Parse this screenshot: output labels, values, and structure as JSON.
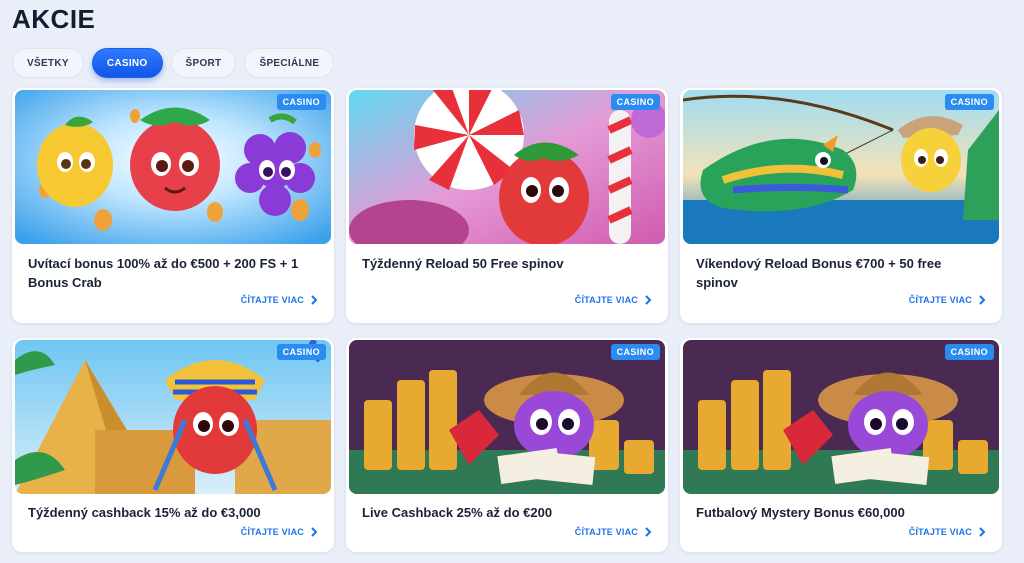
{
  "page": {
    "title": "AKCIE"
  },
  "tabs": [
    {
      "label": "VŠETKY",
      "active": false
    },
    {
      "label": "CASINO",
      "active": true
    },
    {
      "label": "ŠPORT",
      "active": false
    },
    {
      "label": "ŠPECIÁLNE",
      "active": false
    }
  ],
  "promotions": [
    {
      "badge": "CASINO",
      "title": "Uvítací bonus 100% až do €500 + 200 FS + 1 Bonus Crab",
      "link": "ČÍTAJTE VIAC",
      "image": "fruit-characters"
    },
    {
      "badge": "CASINO",
      "title": "Týždenný Reload 50 Free spinov",
      "link": "ČÍTAJTE VIAC",
      "image": "candy-strawberry"
    },
    {
      "badge": "CASINO",
      "title": "Víkendový Reload Bonus €700 + 50 free spinov",
      "link": "ČÍTAJTE VIAC",
      "image": "fishing-scene"
    },
    {
      "badge": "CASINO",
      "title": "Týždenný cashback 15% až do €3,000",
      "link": "ČÍTAJTE VIAC",
      "image": "pharaoh-strawberry"
    },
    {
      "badge": "CASINO",
      "title": "Live Cashback 25% až do €200",
      "link": "ČÍTAJTE VIAC",
      "image": "cowboy-coins"
    },
    {
      "badge": "CASINO",
      "title": "Futbalový Mystery Bonus €60,000",
      "link": "ČÍTAJTE VIAC",
      "image": "cowboy-coins"
    }
  ],
  "colors": {
    "accent": "#1e73e8",
    "badge": "#2a8cf0",
    "background": "#e9eef8"
  }
}
